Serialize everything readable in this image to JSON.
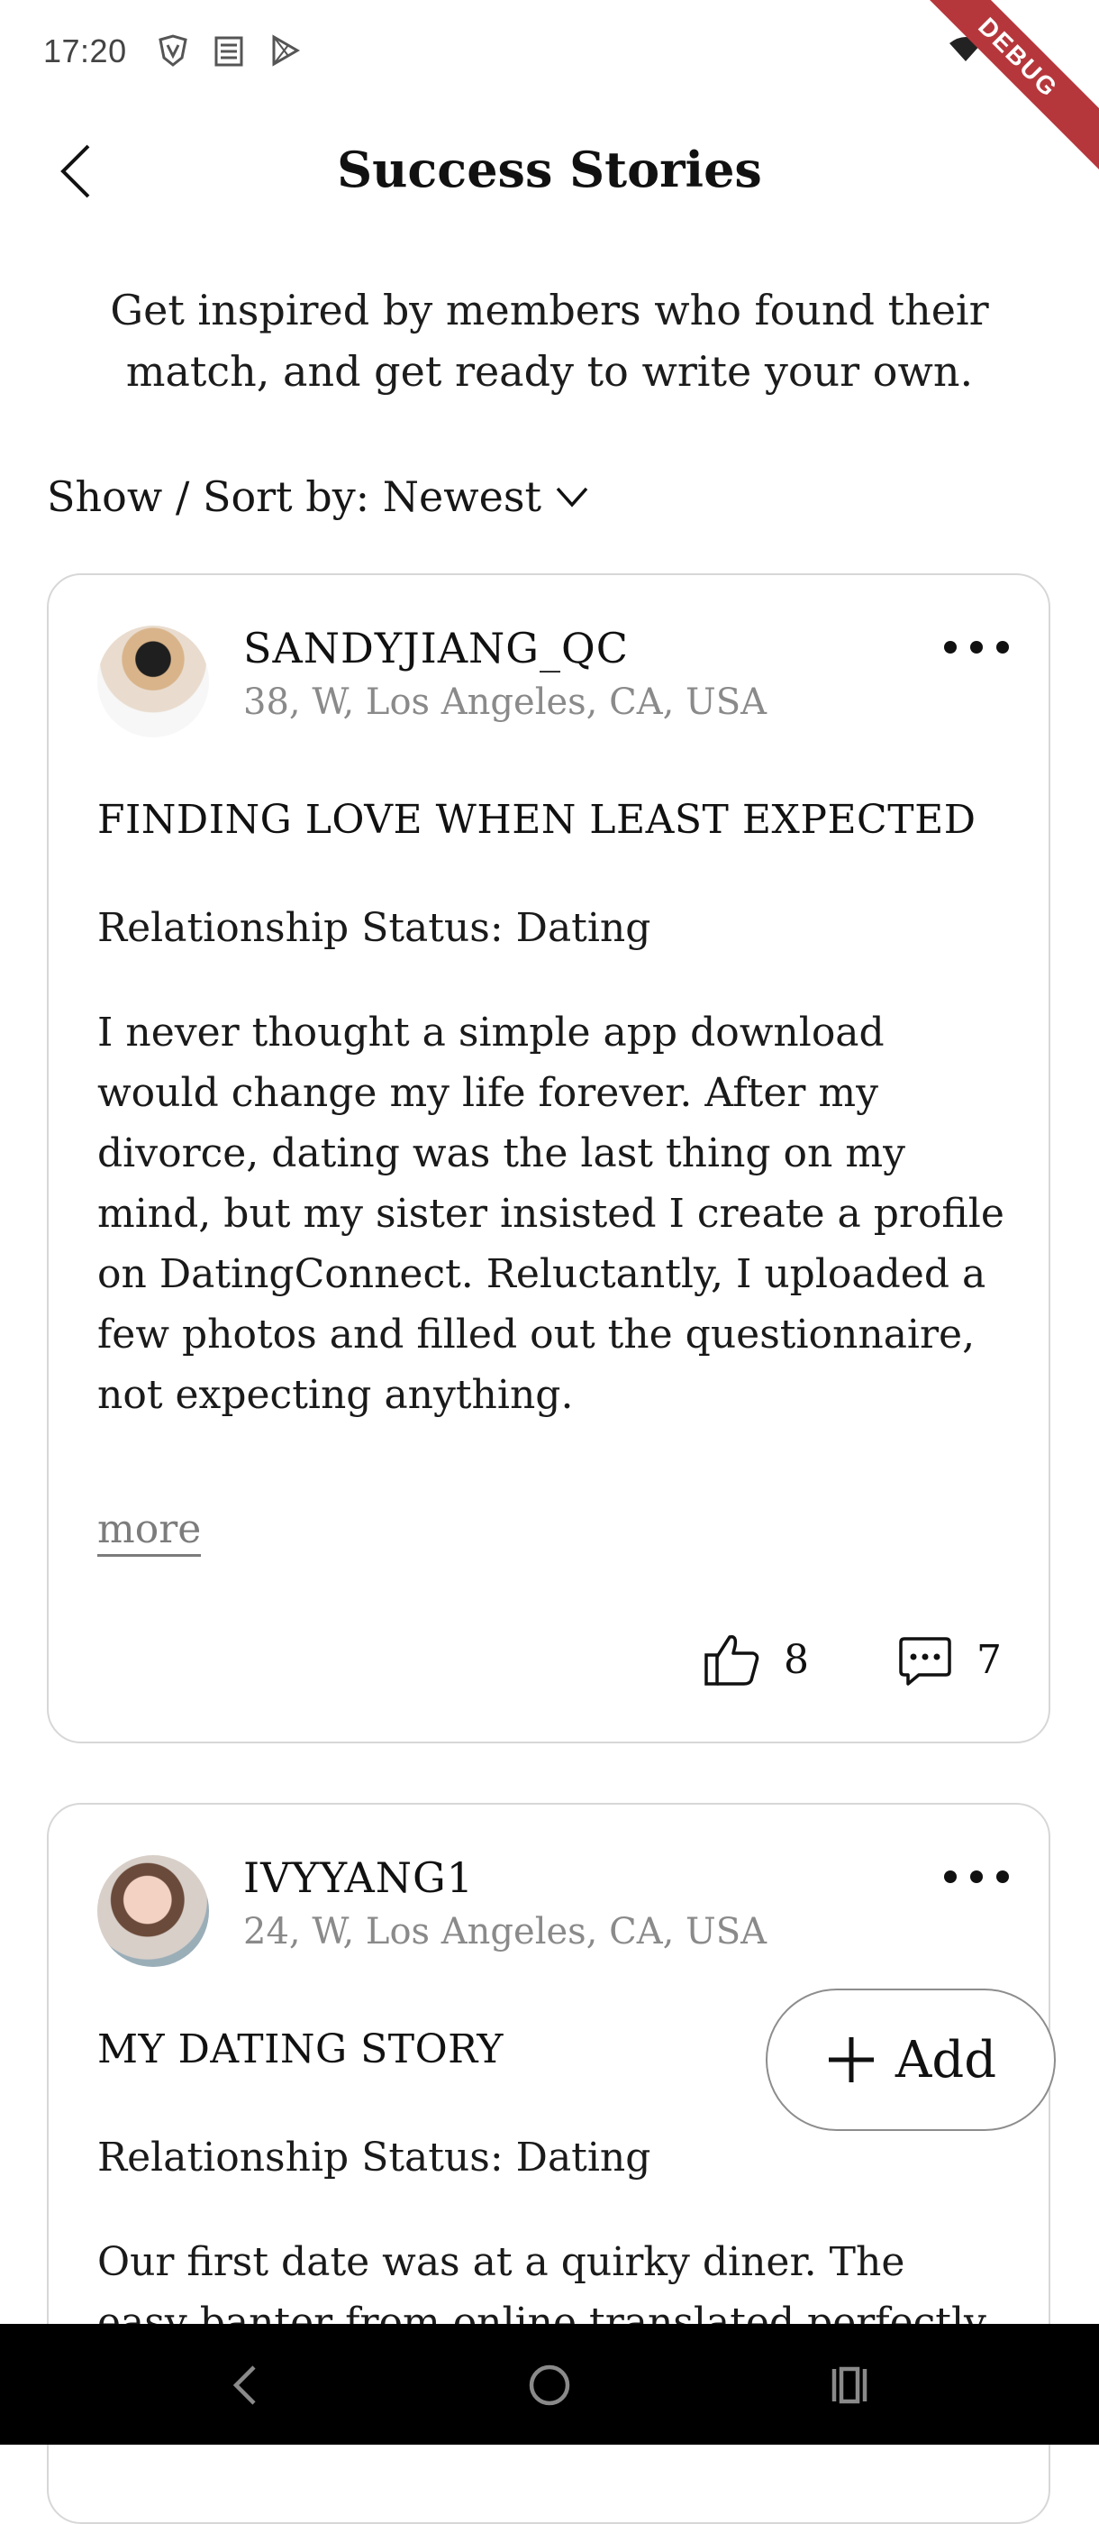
{
  "status_bar": {
    "time": "17:20"
  },
  "debug_banner": "DEBUG",
  "header": {
    "title": "Success Stories"
  },
  "intro_text": "Get inspired by members who found their match, and get ready to write your own.",
  "sort": {
    "label": "Show / Sort by: Newest"
  },
  "stories": [
    {
      "username": "SANDYJIANG_QC",
      "meta": "38, W, Los Angeles, CA, USA",
      "title": "FINDING LOVE WHEN LEAST EXPECTED",
      "relationship_status": "Relationship Status: Dating",
      "body": "I never thought a simple app download would change my life forever. After my divorce, dating was the last thing on my mind, but my sister insisted I create a profile on DatingConnect. Reluctantly, I uploaded a few photos and filled out the questionnaire, not expecting anything.",
      "more_label": "more",
      "likes": "8",
      "comments": "7"
    },
    {
      "username": "IVYYANG1",
      "meta": "24, W, Los Angeles, CA, USA",
      "title": "MY DATING STORY",
      "relationship_status": "Relationship Status: Dating",
      "body": "Our first date was at a quirky diner. The easy banter from online translated perfectly to real"
    }
  ],
  "fab": {
    "label": "Add"
  },
  "icons": {
    "back": "chevron-left-icon",
    "sort": "chevron-down-icon",
    "more": "more-horizontal-icon",
    "like": "thumbs-up-icon",
    "comment": "comment-icon",
    "add": "plus-icon"
  }
}
